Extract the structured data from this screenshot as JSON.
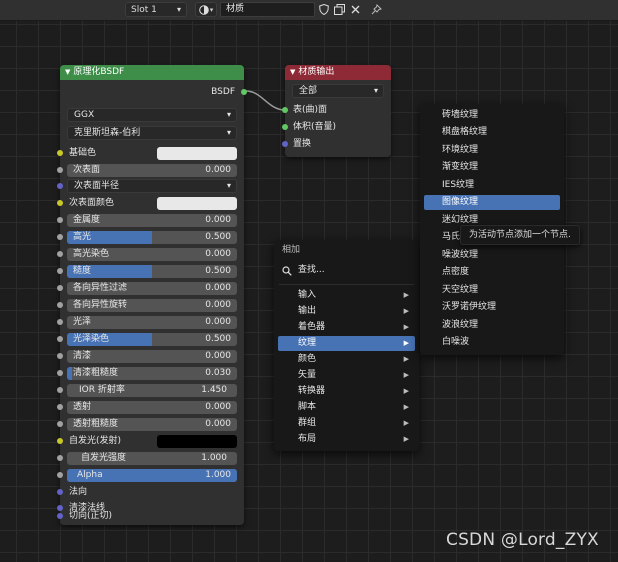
{
  "header": {
    "slot": "Slot 1",
    "material_name": "材质"
  },
  "bsdf_node": {
    "title": "原理化BSDF",
    "output": "BSDF",
    "distribution": "GGX",
    "subsurface_method": "克里斯坦森-伯利",
    "base_color": "基础色",
    "subsurface": {
      "label": "次表面",
      "value": "0.000"
    },
    "subsurface_radius": "次表面半径",
    "subsurface_color": "次表面颜色",
    "metallic": {
      "label": "金属度",
      "value": "0.000"
    },
    "specular": {
      "label": "高光",
      "value": "0.500"
    },
    "specular_tint": {
      "label": "高光染色",
      "value": "0.000"
    },
    "roughness": {
      "label": "糙度",
      "value": "0.500"
    },
    "anisotropic": {
      "label": "各向异性过滤",
      "value": "0.000"
    },
    "anisotropic_rotation": {
      "label": "各向异性旋转",
      "value": "0.000"
    },
    "sheen": {
      "label": "光泽",
      "value": "0.000"
    },
    "sheen_tint": {
      "label": "光泽染色",
      "value": "0.500"
    },
    "clearcoat": {
      "label": "清漆",
      "value": "0.000"
    },
    "clearcoat_roughness": {
      "label": "清漆粗糙度",
      "value": "0.030"
    },
    "ior": {
      "label": "IOR 折射率",
      "value": "1.450"
    },
    "transmission": {
      "label": "透射",
      "value": "0.000"
    },
    "transmission_roughness": {
      "label": "透射粗糙度",
      "value": "0.000"
    },
    "emission": "自发光(发射)",
    "emission_strength": {
      "label": "自发光强度",
      "value": "1.000"
    },
    "alpha": {
      "label": "Alpha",
      "value": "1.000"
    },
    "normal": "法向",
    "clearcoat_normal": "清漆法线",
    "tangent": "切向(正切)"
  },
  "output_node": {
    "title": "材质输出",
    "target": "全部",
    "surface": "表(曲)面",
    "volume": "体积(音量)",
    "displacement": "置换"
  },
  "add_menu": {
    "title": "相加",
    "search": "查找...",
    "items": [
      "输入",
      "输出",
      "着色器",
      "纹理",
      "颜色",
      "矢量",
      "转换器",
      "脚本",
      "群组",
      "布局"
    ]
  },
  "texture_menu": {
    "items": [
      "砖墙纹理",
      "棋盘格纹理",
      "环境纹理",
      "渐变纹理",
      "IES纹理",
      "图像纹理",
      "迷幻纹理",
      "马氏",
      "噪波纹理",
      "点密度",
      "天空纹理",
      "沃罗诺伊纹理",
      "波浪纹理",
      "白噪波"
    ]
  },
  "tooltip": "为活动节点添加一个节点.",
  "watermark": "CSDN @Lord_ZYX",
  "progress": {
    "specular": 0.5,
    "roughness": 0.5,
    "sheen_tint": 0.5,
    "clearcoat_roughness": 0.03,
    "alpha": 1.0
  }
}
